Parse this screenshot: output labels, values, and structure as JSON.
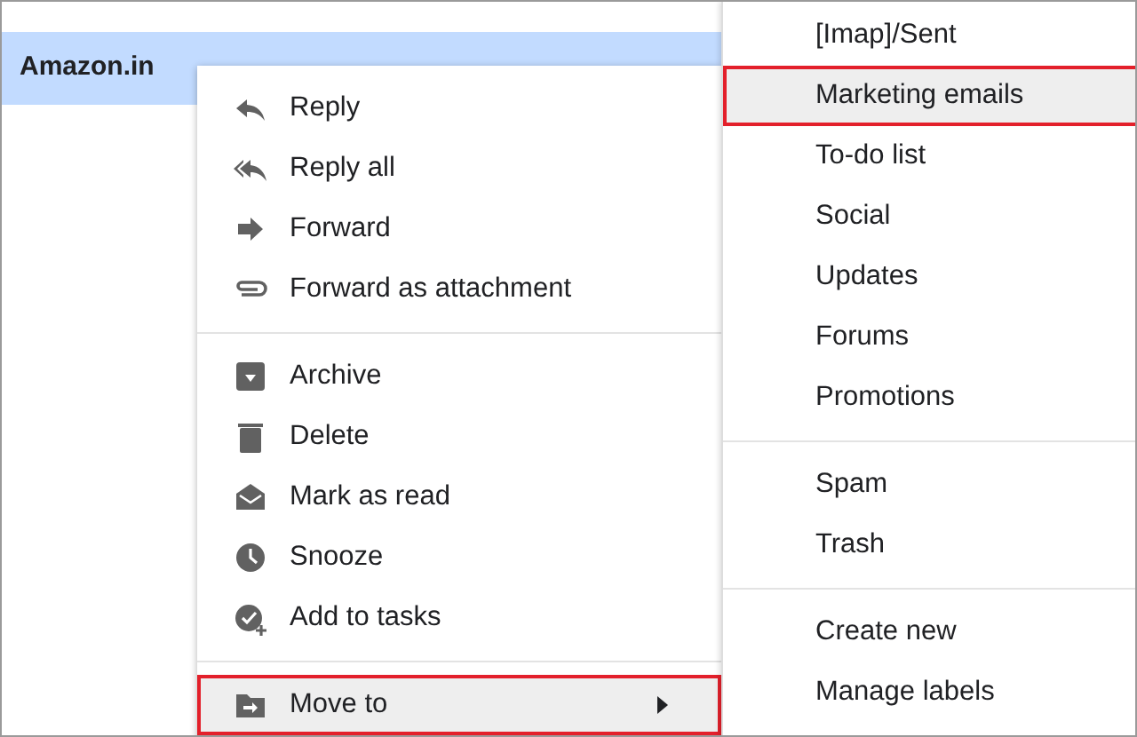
{
  "email_row": {
    "sender": "Amazon.in",
    "selected": true
  },
  "context_menu": {
    "groups": [
      [
        {
          "label": "Reply",
          "selected": false
        },
        {
          "label": "Reply all",
          "selected": false
        },
        {
          "label": "Forward",
          "selected": false
        },
        {
          "label": "Forward as attachment",
          "selected": false
        }
      ],
      [
        {
          "label": "Archive",
          "selected": false
        },
        {
          "label": "Delete",
          "selected": false
        },
        {
          "label": "Mark as read",
          "selected": false
        },
        {
          "label": "Snooze",
          "selected": false
        },
        {
          "label": "Add to tasks",
          "selected": false
        }
      ],
      [
        {
          "label": "Move to",
          "selected": true,
          "submenu": true
        }
      ]
    ]
  },
  "move_to_menu": {
    "groups": [
      [
        {
          "label": "[Imap]/Sent",
          "selected": false
        },
        {
          "label": "Marketing emails",
          "selected": true
        },
        {
          "label": "To-do list",
          "selected": false
        },
        {
          "label": "Social",
          "selected": false
        },
        {
          "label": "Updates",
          "selected": false
        },
        {
          "label": "Forums",
          "selected": false
        },
        {
          "label": "Promotions",
          "selected": false
        }
      ],
      [
        {
          "label": "Spam",
          "selected": false
        },
        {
          "label": "Trash",
          "selected": false
        }
      ],
      [
        {
          "label": "Create new",
          "selected": false
        },
        {
          "label": "Manage labels",
          "selected": false
        }
      ]
    ]
  }
}
